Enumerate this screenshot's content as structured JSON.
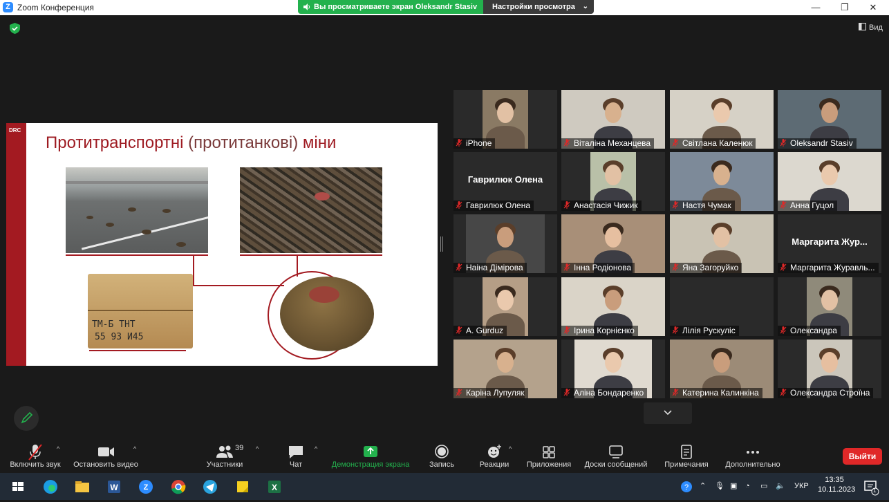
{
  "window": {
    "title": "Zoom Конференция",
    "min": "—",
    "max": "❐",
    "close": "✕"
  },
  "share_banner": {
    "viewing": "Вы просматриваете экран Oleksandr Stasiv",
    "settings": "Настройки просмотра"
  },
  "view_button": "Вид",
  "slide": {
    "tag": "DRC",
    "title": "Протитранспортні",
    "title_paren": "(протитанкові)",
    "title_end": "міни",
    "crate_text_1": "ТМ-Б ТНТ",
    "crate_text_2": "55 93 И45"
  },
  "participants": [
    {
      "name": "iPhone"
    },
    {
      "name": "Віталіна Механцева"
    },
    {
      "name": "Світлана Каленюк"
    },
    {
      "name": "Oleksandr Stasiv",
      "active_speaker": true
    },
    {
      "name": "Гаврилюк Олена",
      "display": "Гаврилюк Олена"
    },
    {
      "name": "Анастасія Чижик"
    },
    {
      "name": "Настя Чумак"
    },
    {
      "name": "Анна Гуцол"
    },
    {
      "name": "Наіна Дімірова"
    },
    {
      "name": "Інна Родіонова"
    },
    {
      "name": "Яна Загоруйко"
    },
    {
      "name": "Маргарита Журавль...",
      "display": "Маргарита Жур..."
    },
    {
      "name": "A. Gurduz"
    },
    {
      "name": "Ірина Корнієнко"
    },
    {
      "name": "Лілія Рускуліс"
    },
    {
      "name": "Олександра"
    },
    {
      "name": "Каріна Лупуляк"
    },
    {
      "name": "Аліна Бондаренко"
    },
    {
      "name": "Катерина Калинкіна"
    },
    {
      "name": "Олександра Строїна"
    }
  ],
  "toolbar": {
    "audio": "Включить звук",
    "video": "Остановить видео",
    "participants": "Участники",
    "participants_count": "39",
    "chat": "Чат",
    "share": "Демонстрация экрана",
    "record": "Запись",
    "reactions": "Реакции",
    "apps": "Приложения",
    "whiteboards": "Доски сообщений",
    "notes": "Примечания",
    "more": "Дополнительно",
    "leave": "Выйти"
  },
  "taskbar": {
    "lang": "УКР",
    "time": "13:35",
    "date": "10.11.2023",
    "notif_count": "1"
  },
  "colors": {
    "share_green": "#23b14d",
    "slide_red": "#a31a21",
    "leave_red": "#e02828",
    "speaker_border": "#d9df5a",
    "zoom_blue": "#2d8cff"
  }
}
